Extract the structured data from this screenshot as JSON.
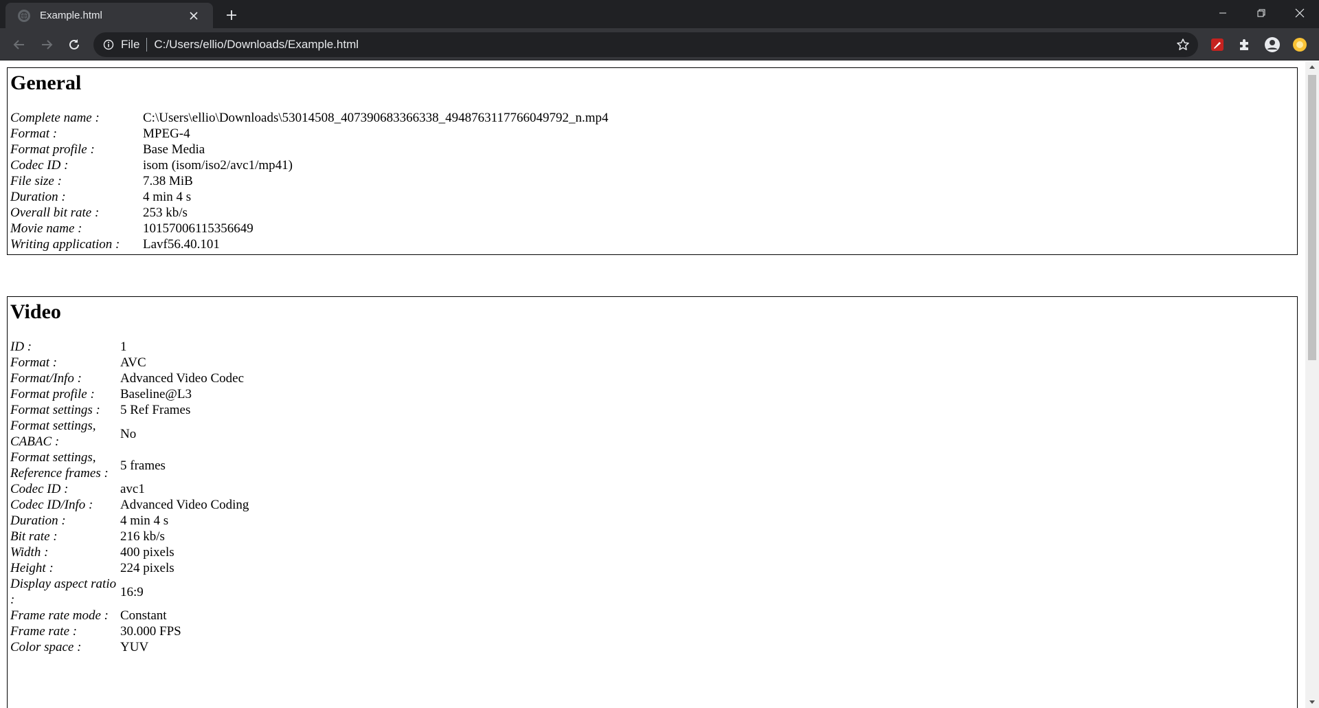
{
  "browser": {
    "tab_title": "Example.html",
    "scheme_label": "File",
    "url": "C:/Users/ellio/Downloads/Example.html",
    "icons": {
      "favicon": "globe-icon",
      "tab_close": "close-icon",
      "new_tab": "plus-icon",
      "minimize": "minimize-icon",
      "restore": "restore-icon",
      "close_window": "close-icon",
      "back": "arrow-left-icon",
      "forward": "arrow-right-icon",
      "reload": "reload-icon",
      "site_info": "info-icon",
      "bookmark": "star-icon",
      "extension_red": "pen-icon",
      "extensions": "puzzle-icon",
      "profile": "account-circle-icon",
      "extension_yellow": "yellow-circle-icon"
    },
    "colors": {
      "titlebar": "#202124",
      "toolbar": "#35363a",
      "text": "#e8eaed"
    }
  },
  "general": {
    "heading": "General",
    "rows": [
      {
        "label": "Complete name :",
        "value": "C:\\Users\\ellio\\Downloads\\53014508_407390683366338_4948763117766049792_n.mp4"
      },
      {
        "label": "Format :",
        "value": "MPEG-4"
      },
      {
        "label": "Format profile :",
        "value": "Base Media"
      },
      {
        "label": "Codec ID :",
        "value": "isom (isom/iso2/avc1/mp41)"
      },
      {
        "label": "File size :",
        "value": "7.38 MiB"
      },
      {
        "label": "Duration :",
        "value": "4 min 4 s"
      },
      {
        "label": "Overall bit rate :",
        "value": "253 kb/s"
      },
      {
        "label": "Movie name :",
        "value": "10157006115356649"
      },
      {
        "label": "Writing application :",
        "value": "Lavf56.40.101"
      }
    ]
  },
  "video": {
    "heading": "Video",
    "rows": [
      {
        "label": "ID :",
        "value": "1"
      },
      {
        "label": "Format :",
        "value": "AVC"
      },
      {
        "label": "Format/Info :",
        "value": "Advanced Video Codec"
      },
      {
        "label": "Format profile :",
        "value": "Baseline@L3"
      },
      {
        "label": "Format settings :",
        "value": "5 Ref Frames"
      },
      {
        "label": "Format settings, CABAC :",
        "value": "No"
      },
      {
        "label": "Format settings, Reference frames :",
        "value": "5 frames"
      },
      {
        "label": "Codec ID :",
        "value": "avc1"
      },
      {
        "label": "Codec ID/Info :",
        "value": "Advanced Video Coding"
      },
      {
        "label": "Duration :",
        "value": "4 min 4 s"
      },
      {
        "label": "Bit rate :",
        "value": "216 kb/s"
      },
      {
        "label": "Width :",
        "value": "400 pixels"
      },
      {
        "label": "Height :",
        "value": "224 pixels"
      },
      {
        "label": "Display aspect ratio :",
        "value": "16:9"
      },
      {
        "label": "Frame rate mode :",
        "value": "Constant"
      },
      {
        "label": "Frame rate :",
        "value": "30.000 FPS"
      },
      {
        "label": "Color space :",
        "value": "YUV"
      }
    ]
  }
}
